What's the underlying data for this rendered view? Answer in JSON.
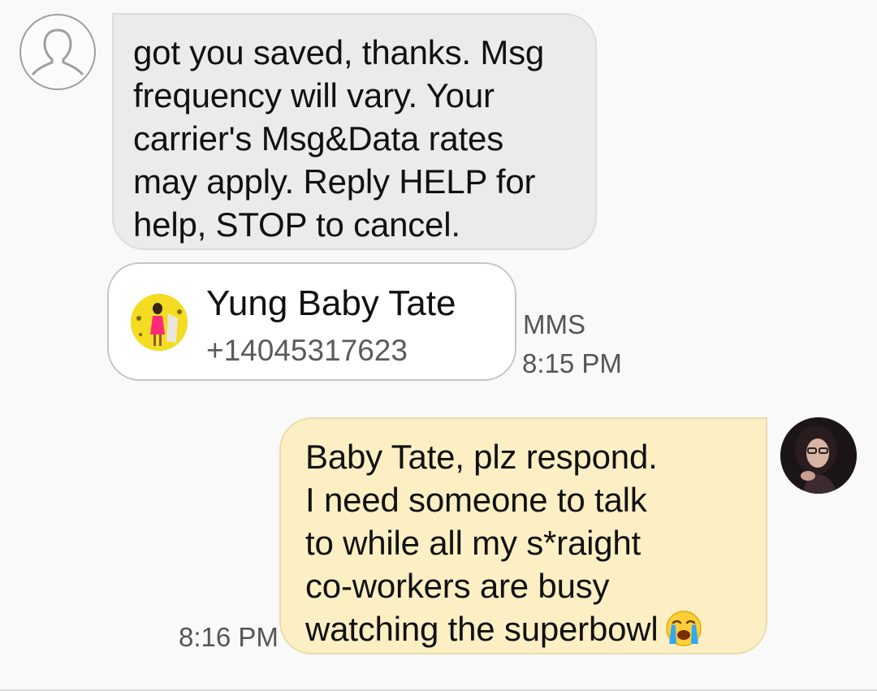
{
  "conversation": {
    "incoming": {
      "avatar_icon": "person-outline-icon",
      "message": "got you saved, thanks. Msg\nfrequency will vary. Your\ncarrier's Msg&Data rates\nmay apply. Reply HELP for\nhelp, STOP to cancel."
    },
    "contact_card": {
      "name": "Yung Baby Tate",
      "number": "+14045317623",
      "type_label": "MMS",
      "time": "8:15 PM"
    },
    "outgoing": {
      "message": "Baby Tate, plz respond.\nI need someone to talk\nto while all my s*raight\nco-workers are busy\nwatching the superbowl",
      "emoji": "loudly-crying-face-icon",
      "time": "8:16 PM"
    }
  },
  "colors": {
    "incoming_bubble": "#ebebeb",
    "outgoing_bubble": "#fdefc4",
    "contact_photo_bg": "#f2d91f",
    "meta_text": "#555555"
  }
}
